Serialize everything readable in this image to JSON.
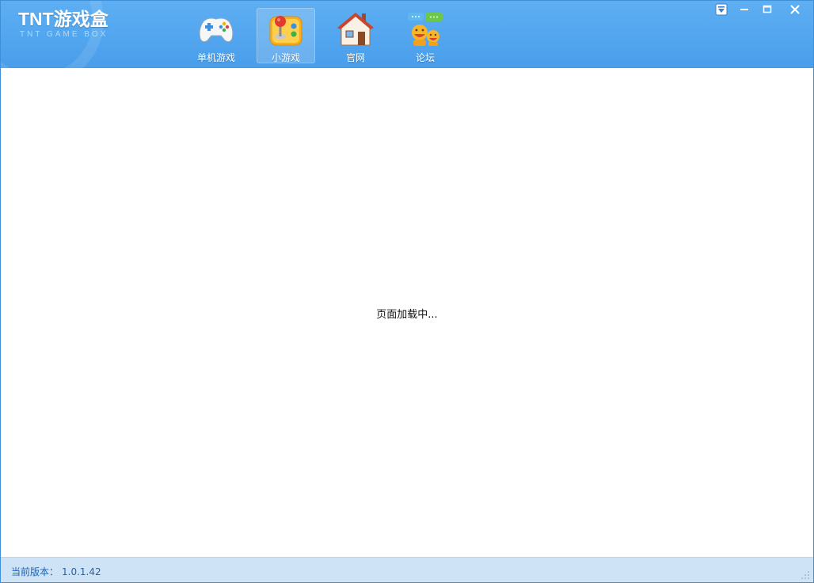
{
  "app": {
    "title": "TNT游戏盒",
    "subtitle": "TNT GAME BOX"
  },
  "nav": {
    "items": [
      {
        "label": "单机游戏",
        "icon": "gamepad-icon",
        "active": false
      },
      {
        "label": "小游戏",
        "icon": "joystick-icon",
        "active": true
      },
      {
        "label": "官网",
        "icon": "house-icon",
        "active": false
      },
      {
        "label": "论坛",
        "icon": "chat-people-icon",
        "active": false
      }
    ]
  },
  "window_controls": [
    "menu-dropdown-icon",
    "minimize-icon",
    "maximize-icon",
    "close-icon"
  ],
  "content": {
    "loading_text": "页面加载中..."
  },
  "status": {
    "version_label": "当前版本：",
    "version": "1.0.1.42"
  },
  "colors": {
    "header": "#52a6ef",
    "statusbar": "#cfe3f6",
    "version_text": "#1a64b4"
  }
}
